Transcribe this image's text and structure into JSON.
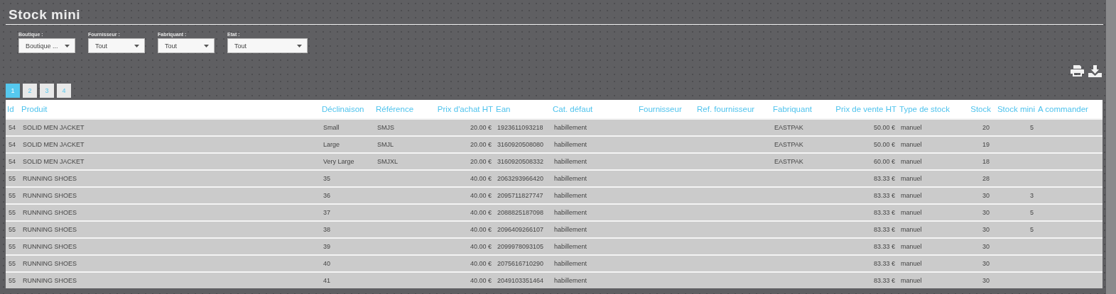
{
  "title": "Stock mini",
  "filters": [
    {
      "label": "Boutique :",
      "value": "Boutique ..."
    },
    {
      "label": "Fournisseur :",
      "value": "Tout"
    },
    {
      "label": "Fabriquant :",
      "value": "Tout"
    },
    {
      "label": "Etat :",
      "value": "Tout"
    }
  ],
  "pagination": [
    {
      "label": "1",
      "selected": true
    },
    {
      "label": "2",
      "selected": false
    },
    {
      "label": "3",
      "selected": false
    },
    {
      "label": "4",
      "selected": false
    }
  ],
  "table": {
    "columns": [
      "Id",
      "Produit",
      "Déclinaison",
      "Référence",
      "Prix d'achat HT",
      "Ean",
      "Cat. défaut",
      "Fournisseur",
      "Ref. fournisseur",
      "Fabriquant",
      "Prix de vente HT",
      "Type de stock",
      "Stock",
      "Stock mini",
      "A commander"
    ],
    "rows": [
      [
        "54",
        "SOLID MEN JACKET",
        "Small",
        "SMJS",
        "20.00 €",
        "1923611093218",
        "habillement",
        "",
        "",
        "EASTPAK",
        "50.00 €",
        "manuel",
        "20",
        "5",
        ""
      ],
      [
        "54",
        "SOLID MEN JACKET",
        "Large",
        "SMJL",
        "20.00 €",
        "3160920508080",
        "habillement",
        "",
        "",
        "EASTPAK",
        "50.00 €",
        "manuel",
        "19",
        "",
        ""
      ],
      [
        "54",
        "SOLID MEN JACKET",
        "Very Large",
        "SMJXL",
        "20.00 €",
        "3160920508332",
        "habillement",
        "",
        "",
        "EASTPAK",
        "60.00 €",
        "manuel",
        "18",
        "",
        ""
      ],
      [
        "55",
        "RUNNING SHOES",
        "35",
        "",
        "40.00 €",
        "2063293966420",
        "habillement",
        "",
        "",
        "",
        "83.33 €",
        "manuel",
        "28",
        "",
        ""
      ],
      [
        "55",
        "RUNNING SHOES",
        "36",
        "",
        "40.00 €",
        "2095711827747",
        "habillement",
        "",
        "",
        "",
        "83.33 €",
        "manuel",
        "30",
        "3",
        ""
      ],
      [
        "55",
        "RUNNING SHOES",
        "37",
        "",
        "40.00 €",
        "2088825187098",
        "habillement",
        "",
        "",
        "",
        "83.33 €",
        "manuel",
        "30",
        "5",
        ""
      ],
      [
        "55",
        "RUNNING SHOES",
        "38",
        "",
        "40.00 €",
        "2096409266107",
        "habillement",
        "",
        "",
        "",
        "83.33 €",
        "manuel",
        "30",
        "5",
        ""
      ],
      [
        "55",
        "RUNNING SHOES",
        "39",
        "",
        "40.00 €",
        "2099978093105",
        "habillement",
        "",
        "",
        "",
        "83.33 €",
        "manuel",
        "30",
        "",
        ""
      ],
      [
        "55",
        "RUNNING SHOES",
        "40",
        "",
        "40.00 €",
        "2075616710290",
        "habillement",
        "",
        "",
        "",
        "83.33 €",
        "manuel",
        "30",
        "",
        ""
      ],
      [
        "55",
        "RUNNING SHOES",
        "41",
        "",
        "40.00 €",
        "2049103351464",
        "habillement",
        "",
        "",
        "",
        "83.33 €",
        "manuel",
        "30",
        "",
        ""
      ]
    ]
  }
}
